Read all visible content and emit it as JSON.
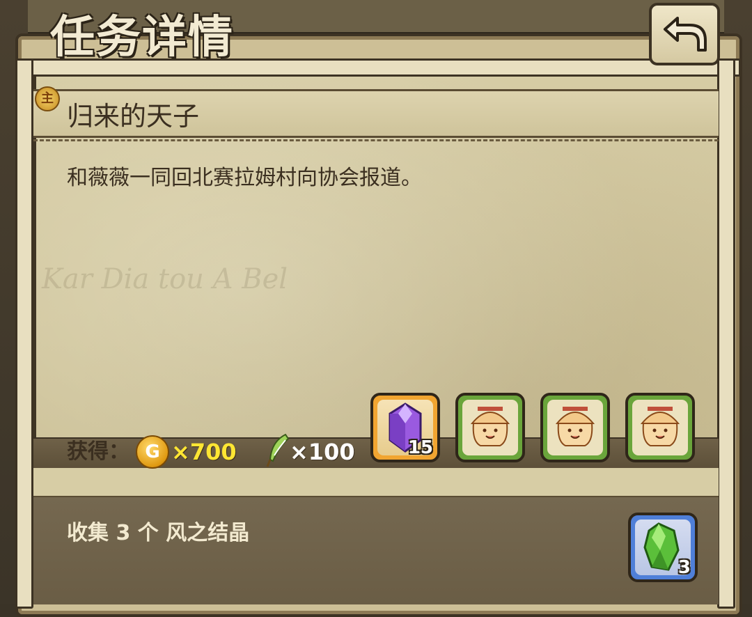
{
  "header": {
    "title": "任务详情",
    "back_label": "back"
  },
  "quest": {
    "badge": "主",
    "title": "归来的天子",
    "description": "和薇薇一同回北赛拉姆村向协会报道。"
  },
  "rewards": {
    "label": "获得：",
    "gold": {
      "icon": "gold-coin-icon",
      "symbol": "G",
      "amount": "×700"
    },
    "feather": {
      "icon": "feather-icon",
      "amount": "×100"
    },
    "items": [
      {
        "icon": "purple-crystal-icon",
        "count": "15",
        "frame": "orange"
      },
      {
        "icon": "mushroom-pet-icon",
        "count": "",
        "frame": "green"
      },
      {
        "icon": "mushroom-pet-icon",
        "count": "",
        "frame": "green"
      },
      {
        "icon": "mushroom-pet-icon",
        "count": "",
        "frame": "green"
      }
    ]
  },
  "objective": {
    "text": "收集 3 个 风之结晶",
    "item": {
      "icon": "green-crystal-icon",
      "count": "3",
      "frame": "blue"
    }
  },
  "colors": {
    "gold_text": "#ffe633",
    "panel_parchment": "#cfc49b",
    "frame_dark": "#3c3223"
  }
}
